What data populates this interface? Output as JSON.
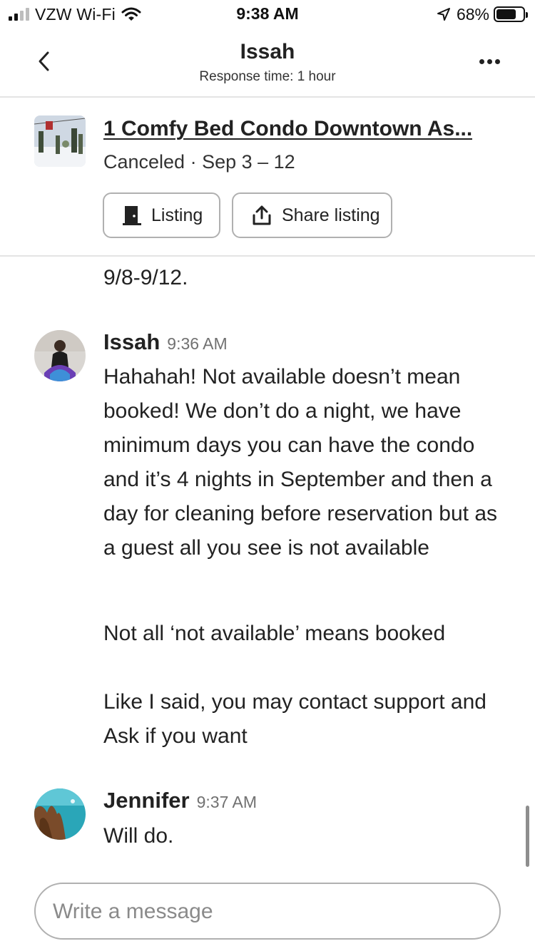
{
  "status_bar": {
    "carrier": "VZW Wi-Fi",
    "time": "9:38 AM",
    "battery": "68%",
    "battery_level": 0.68,
    "signal_bars": 2,
    "icons": [
      "signal-icon",
      "wifi-icon",
      "location-arrow-icon",
      "battery-icon"
    ]
  },
  "header": {
    "title": "Issah",
    "subtitle": "Response time: 1 hour",
    "icons": [
      "chevron-left-icon",
      "more-icon"
    ]
  },
  "listing": {
    "title": "1 Comfy Bed Condo Downtown As...",
    "status": "Canceled · Sep 3 – 12",
    "listing_button": "Listing",
    "share_button": "Share listing",
    "icons": [
      "door-icon",
      "share-icon"
    ]
  },
  "messages": {
    "partial": "9/8-9/12.",
    "items": [
      {
        "sender": "Issah",
        "time": "9:36 AM",
        "paragraphs": [
          "Hahahah! Not available doesn’t mean booked! We don’t do a night, we have minimum days you can have the condo and it’s 4 nights in September and then a day for cleaning before reservation but as a guest all you see is not available",
          "Not all ‘not available’ means booked",
          "Like I said, you may contact support and Ask if you want"
        ]
      },
      {
        "sender": "Jennifer",
        "time": "9:37 AM",
        "paragraphs": [
          "Will do."
        ]
      }
    ]
  },
  "composer": {
    "placeholder": "Write a message"
  },
  "colors": {
    "text": "#222222",
    "muted": "#717171",
    "border": "#b0b0b0",
    "divider": "#e4e4e4"
  }
}
